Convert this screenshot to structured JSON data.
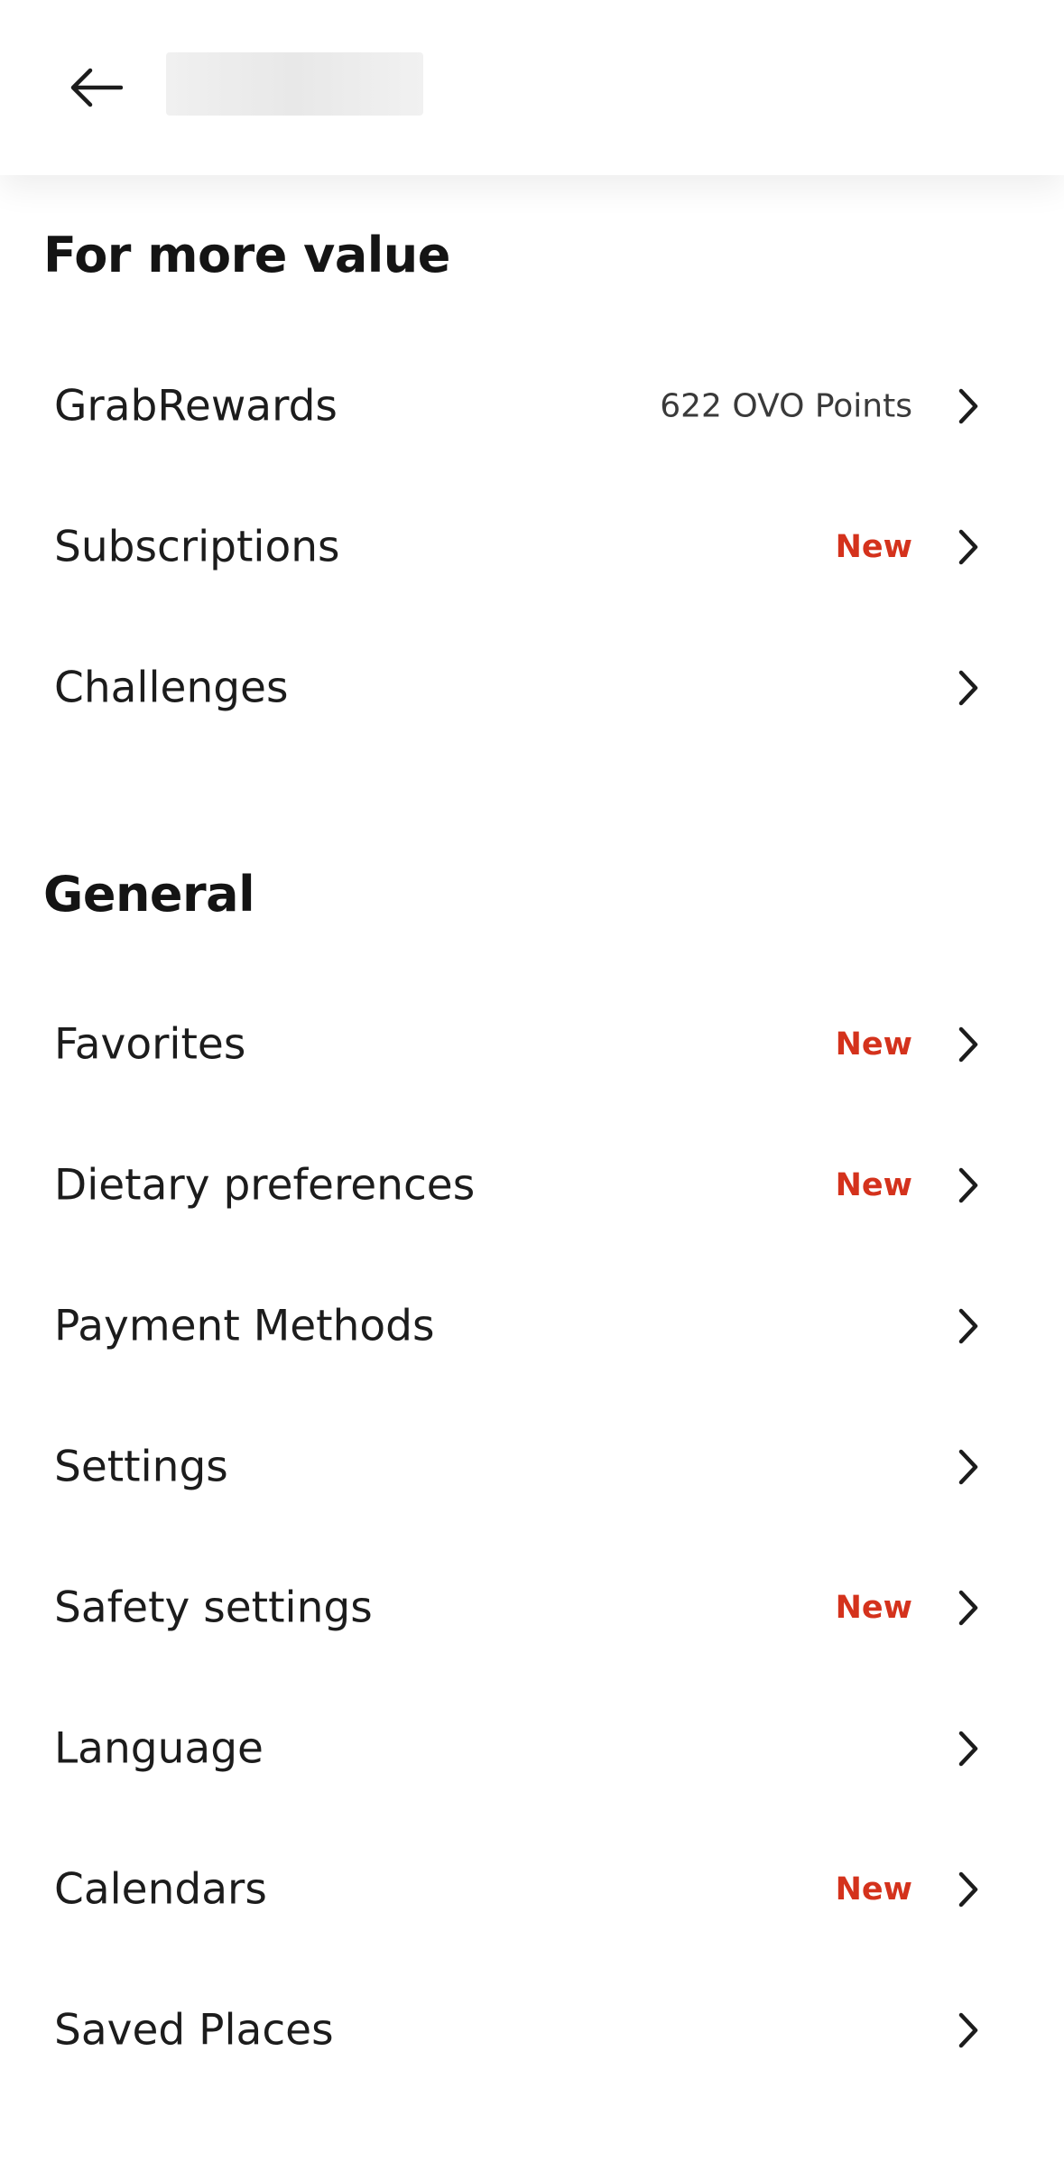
{
  "colors": {
    "badge": "#d4321c",
    "text": "#1c1c1c",
    "icon": "#1c1c1c"
  },
  "header": {
    "back_icon": "arrow-left-icon"
  },
  "sections": {
    "value": {
      "title": "For more value",
      "items": [
        {
          "label": "GrabRewards",
          "value": "622 OVO Points",
          "badge": ""
        },
        {
          "label": "Subscriptions",
          "value": "",
          "badge": "New"
        },
        {
          "label": "Challenges",
          "value": "",
          "badge": ""
        }
      ]
    },
    "general": {
      "title": "General",
      "items": [
        {
          "label": "Favorites",
          "value": "",
          "badge": "New"
        },
        {
          "label": "Dietary preferences",
          "value": "",
          "badge": "New"
        },
        {
          "label": "Payment Methods",
          "value": "",
          "badge": ""
        },
        {
          "label": "Settings",
          "value": "",
          "badge": ""
        },
        {
          "label": "Safety settings",
          "value": "",
          "badge": "New"
        },
        {
          "label": "Language",
          "value": "",
          "badge": ""
        },
        {
          "label": "Calendars",
          "value": "",
          "badge": "New"
        },
        {
          "label": "Saved Places",
          "value": "",
          "badge": ""
        }
      ]
    }
  },
  "chevron_icon": "chevron-right-icon"
}
